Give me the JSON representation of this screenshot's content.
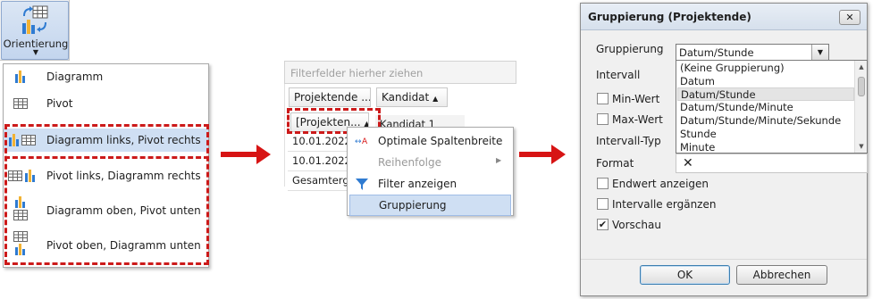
{
  "panel1": {
    "ribbon_button_label": "Orientierung",
    "menu_items": [
      {
        "label": "Diagramm",
        "icon": "bar-chart-icon"
      },
      {
        "label": "Pivot",
        "icon": "pivot-grid-icon"
      },
      {
        "label": "Diagramm links, Pivot rechts",
        "icon": "chart-left-pivot-right-icon"
      },
      {
        "label": "Pivot links, Diagramm rechts",
        "icon": "pivot-left-chart-right-icon"
      },
      {
        "label": "Diagramm oben, Pivot unten",
        "icon": "chart-top-pivot-bottom-icon"
      },
      {
        "label": "Pivot oben, Diagramm unten",
        "icon": "pivot-top-chart-bottom-icon"
      }
    ],
    "selected_item": "Diagramm links, Pivot rechts"
  },
  "panel2": {
    "filter_placeholder": "Filterfelder hierher ziehen",
    "column_header_1": "Projektende ...",
    "column_header_2": "Kandidat",
    "row_field_header": "[Projekten...",
    "column_value": "Kandidat 1",
    "rows": [
      "10.01.2022 1",
      "10.01.2022 1",
      "Gesamtergebn"
    ],
    "context_menu": [
      {
        "label": "Optimale Spaltenbreite",
        "icon": "column-width-icon",
        "enabled": true
      },
      {
        "label": "Reihenfolge",
        "icon": "",
        "enabled": false,
        "submenu": true
      },
      {
        "label": "Filter anzeigen",
        "icon": "filter-icon",
        "enabled": true
      },
      {
        "label": "Gruppierung",
        "icon": "",
        "enabled": true,
        "highlighted": true
      }
    ]
  },
  "dialog": {
    "title": "Gruppierung (Projektende)",
    "close_glyph": "✕",
    "labels": {
      "gruppierung": "Gruppierung",
      "intervall": "Intervall",
      "min_wert": "Min-Wert",
      "max_wert": "Max-Wert",
      "intervall_typ": "Intervall-Typ",
      "format": "Format"
    },
    "combo_value": "Datum/Stunde",
    "dropdown_options": [
      "(Keine Gruppierung)",
      "Datum",
      "Datum/Stunde",
      "Datum/Stunde/Minute",
      "Datum/Stunde/Minute/Sekunde",
      "Stunde",
      "Minute"
    ],
    "dropdown_selected": "Datum/Stunde",
    "format_clear_glyph": "✕",
    "checkboxes": [
      {
        "label": "Endwert anzeigen",
        "checked": false
      },
      {
        "label": "Intervalle ergänzen",
        "checked": false
      },
      {
        "label": "Vorschau",
        "checked": true
      }
    ],
    "ok_label": "OK",
    "cancel_label": "Abbrechen"
  },
  "colors": {
    "accent_red": "#d71414",
    "selection_blue": "#cfdff3"
  }
}
